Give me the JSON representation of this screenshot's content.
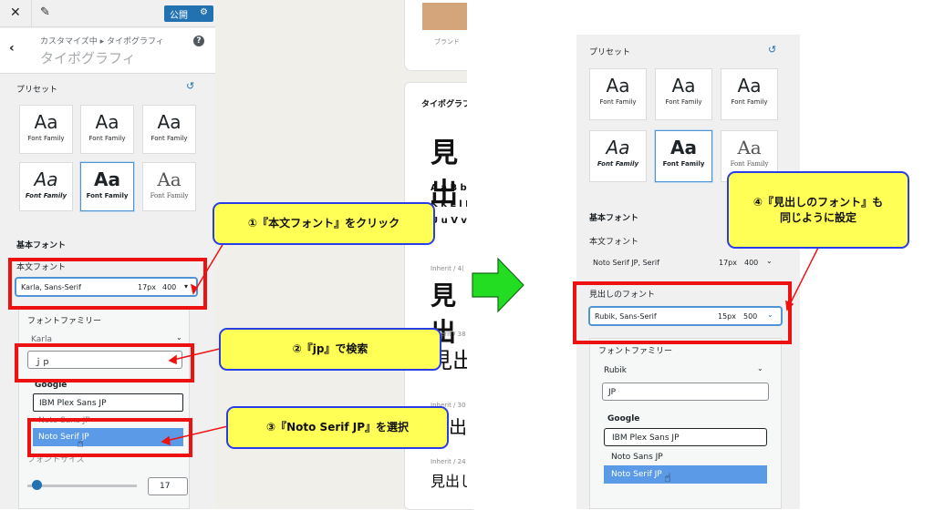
{
  "left": {
    "topbar": {
      "close": "✕",
      "edit": "✎",
      "publish": "公開",
      "gear": "⚙"
    },
    "header": {
      "back": "‹",
      "breadcrumb": "カスタマイズ中 ▸ タイポグラフィ",
      "title": "タイポグラフィ",
      "help": "?"
    },
    "preset_label": "プリセット",
    "reset": "↺",
    "cards": [
      {
        "aa": "Aa",
        "ff": "Font Family"
      },
      {
        "aa": "Aa",
        "ff": "Font Family"
      },
      {
        "aa": "Aa",
        "ff": "Font Family"
      },
      {
        "aa": "Aa",
        "ff": "Font Family"
      },
      {
        "aa": "Aa",
        "ff": "Font Family"
      },
      {
        "aa": "Aa",
        "ff": "Font Family"
      }
    ],
    "base_font": "基本フォント",
    "body_font_label": "本文フォント",
    "body_font": {
      "value": "Karla, Sans-Serif",
      "size": "17px",
      "weight": "400"
    },
    "font_family_label": "フォントファミリー",
    "family_value": "Karla",
    "search_value": "ｊｐ",
    "group_google": "Google",
    "options": [
      "IBM Plex Sans JP",
      "Noto Sans JP",
      "Noto Serif JP"
    ],
    "size_label": "フォントサイズ",
    "size_value": "17"
  },
  "preview": {
    "brand": "ブランド",
    "typo_label": "タイポグラフ",
    "heading": "見出",
    "alpha1": "A a B b",
    "alpha2": "K k L l N",
    "alpha3": "U u V v",
    "inh1": "Inherit / 4(",
    "big1": "見出",
    "inh2": "Inherit / 38",
    "big2": "見出",
    "inh3": "Inherit / 30",
    "big3": "見出",
    "inh4": "Inherit / 24",
    "big4": "見出し"
  },
  "callouts": {
    "c1": "①『本文フォント』をクリック",
    "c2": "②『jp』で検索",
    "c3": "③『Noto Serif JP』を選択",
    "c4_line1": "④『見出しのフォント』も",
    "c4_line2": "同じように設定"
  },
  "right": {
    "preset_label": "プリセット",
    "reset": "↺",
    "cards": [
      {
        "aa": "Aa",
        "ff": "Font Family"
      },
      {
        "aa": "Aa",
        "ff": "Font Family"
      },
      {
        "aa": "Aa",
        "ff": "Font Family"
      },
      {
        "aa": "Aa",
        "ff": "Font Family"
      },
      {
        "aa": "Aa",
        "ff": "Font Family"
      },
      {
        "aa": "Aa",
        "ff": "Font Family"
      }
    ],
    "base_font": "基本フォント",
    "body_font_label": "本文フォント",
    "body_font": {
      "value": "Noto Serif JP, Serif",
      "size": "17px",
      "weight": "400"
    },
    "heading_font_label": "見出しのフォント",
    "heading_font": {
      "value": "Rubik, Sans-Serif",
      "size": "15px",
      "weight": "500"
    },
    "font_family_label": "フォントファミリー",
    "family_value": "Rubik",
    "search_value": "JP",
    "group_google": "Google",
    "options": [
      "IBM Plex Sans JP",
      "Noto Sans JP",
      "Noto Serif JP"
    ]
  },
  "colors": {
    "callout_fill": "#ffff55",
    "callout_border": "#2a3ee8",
    "highlight_red": "#ee1111",
    "selected_blue": "#4f94d4",
    "arrow_green": "#22dd22"
  }
}
